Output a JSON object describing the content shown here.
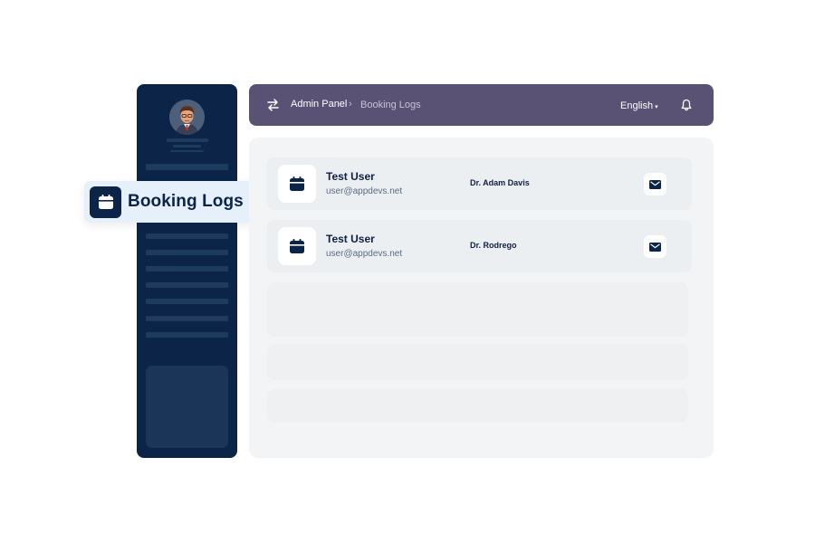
{
  "colors": {
    "sidebar": "#0c2447",
    "topbar": "#5a5275",
    "panel": "#f3f4f6",
    "badge": "#e5f0fb"
  },
  "badge": {
    "icon": "calendar-icon",
    "label": "Booking Logs"
  },
  "topbar": {
    "menu_icon": "swap-arrows-icon",
    "breadcrumb": {
      "root": "Admin Panel",
      "separator": "›",
      "current": "Booking Logs"
    },
    "language": "English",
    "language_caret": "▾",
    "notification_icon": "bell-icon"
  },
  "bookings": [
    {
      "icon": "calendar-icon",
      "user_name": "Test User",
      "user_email": "user@appdevs.net",
      "doctor": "Dr. Adam Davis",
      "action_icon": "mail-icon"
    },
    {
      "icon": "calendar-icon",
      "user_name": "Test User",
      "user_email": "user@appdevs.net",
      "doctor": "Dr. Rodrego",
      "action_icon": "mail-icon"
    }
  ]
}
